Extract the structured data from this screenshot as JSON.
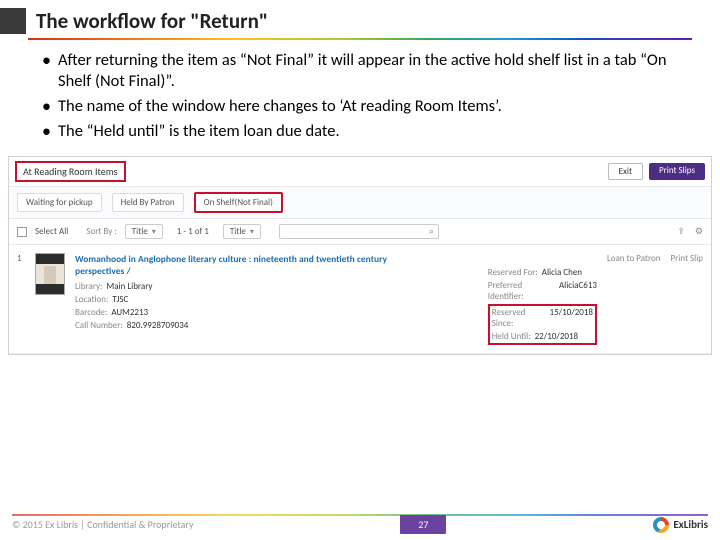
{
  "header": {
    "title": "The workflow for \"Return\""
  },
  "bullets": [
    "After returning the item as “Not Final” it will appear in the active hold shelf list in a tab “On Shelf (Not Final)”.",
    "The name of the window here changes to ‘At reading Room Items’.",
    "The “Held until” is the item loan due date."
  ],
  "screenshot": {
    "windowTitle": "At Reading Room Items",
    "topButtons": {
      "exit": "Exit",
      "printSlips": "Print Slips"
    },
    "tabs": [
      {
        "label": "Waiting for pickup"
      },
      {
        "label": "Held By Patron"
      },
      {
        "label": "On Shelf(Not Final)",
        "highlighted": true
      }
    ],
    "toolbar": {
      "selectAll": "Select All",
      "sortByLabel": "Sort By :",
      "sortByValue": "Title",
      "range": "1 - 1 of 1",
      "viewValue": "Title",
      "exportBtn": "export",
      "settingsBtn": "settings"
    },
    "item": {
      "index": "1",
      "title": "Womanhood in Anglophone literary culture : nineteenth and twentieth century perspectives /",
      "left": {
        "libraryLbl": "Library:",
        "library": "Main Library",
        "locationLbl": "Location:",
        "location": "TJSC",
        "barcodeLbl": "Barcode:",
        "barcode": "AUM2213",
        "callNumberLbl": "Call Number:",
        "callNumber": "820.9928709034"
      },
      "right": {
        "reservedForLbl": "Reserved For:",
        "reservedFor": "Alicia Chen",
        "preferredIdLbl": "Preferred Identifier:",
        "preferredId": "AliciaC613",
        "reservedSinceLbl": "Reserved Since:",
        "reservedSince": "15/10/2018",
        "heldUntilLbl": "Held Until:",
        "heldUntil": "22/10/2018"
      },
      "actions": {
        "loan": "Loan to Patron",
        "print": "Print Slip"
      }
    }
  },
  "footer": {
    "copyright": "© 2015 Ex Libris | Confidential & Proprietary",
    "page": "27",
    "logoText": "ExLibris"
  }
}
